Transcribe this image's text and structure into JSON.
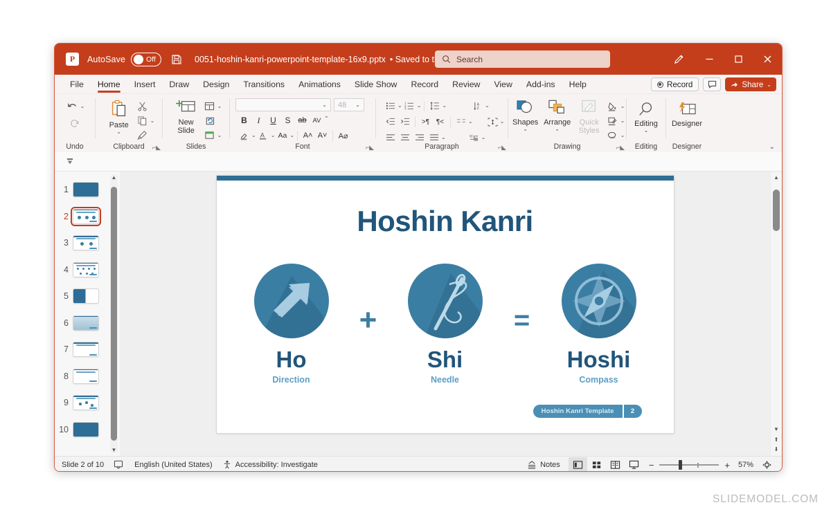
{
  "titlebar": {
    "app_icon": "powerpoint-logo-icon",
    "autosave_label": "AutoSave",
    "autosave_state": "Off",
    "save_icon": "save-icon",
    "document_title": "0051-hoshin-kanri-powerpoint-template-16x9.pptx",
    "save_status": "• Saved to this PC",
    "title_chevron": "⌄",
    "search_placeholder": "Search",
    "search_icon": "search-icon",
    "pen_icon": "pen-annotate-icon",
    "minimize": "—",
    "maximize": "▢",
    "close": "✕"
  },
  "ribbon": {
    "tabs": [
      {
        "label": "File",
        "active": false
      },
      {
        "label": "Home",
        "active": true
      },
      {
        "label": "Insert",
        "active": false
      },
      {
        "label": "Draw",
        "active": false
      },
      {
        "label": "Design",
        "active": false
      },
      {
        "label": "Transitions",
        "active": false
      },
      {
        "label": "Animations",
        "active": false
      },
      {
        "label": "Slide Show",
        "active": false
      },
      {
        "label": "Record",
        "active": false
      },
      {
        "label": "Review",
        "active": false
      },
      {
        "label": "View",
        "active": false
      },
      {
        "label": "Add-ins",
        "active": false
      },
      {
        "label": "Help",
        "active": false
      }
    ],
    "record_button": "Record",
    "comments_icon": "comment-icon",
    "share_button": "Share",
    "share_chevron": "⌄",
    "collapse_chevron": "⌄",
    "groups": [
      {
        "title": "Undo",
        "items": [
          "undo-icon",
          "redo-icon"
        ]
      },
      {
        "title": "Clipboard",
        "items": [
          "paste-icon",
          "cut-icon",
          "copy-icon",
          "format-painter-icon"
        ],
        "paste_label": "Paste"
      },
      {
        "title": "Slides",
        "items": [
          "new-slide-icon",
          "layout-icon",
          "reset-icon",
          "section-icon"
        ],
        "new_slide_label": "New\nSlide"
      },
      {
        "title": "Font",
        "font_name_value": "",
        "font_size_value": "48",
        "items": [
          "bold-icon",
          "italic-icon",
          "underline-icon",
          "shadow-icon",
          "strikethrough-icon",
          "character-spacing-icon",
          "text-highlight-icon",
          "font-color-icon",
          "change-case-icon",
          "increase-font-size-icon",
          "decrease-font-size-icon",
          "clear-formatting-icon"
        ]
      },
      {
        "title": "Paragraph",
        "items": [
          "bullets-icon",
          "numbering-icon",
          "line-spacing-icon",
          "text-direction-icon",
          "decrease-indent-icon",
          "increase-indent-icon",
          "ltr-icon",
          "rtl-icon",
          "columns-icon",
          "align-text-icon",
          "align-left-icon",
          "align-center-icon",
          "align-right-icon",
          "justify-icon",
          "convert-smartart-icon"
        ]
      },
      {
        "title": "Drawing",
        "shapes_label": "Shapes",
        "arrange_label": "Arrange",
        "quick_styles_label": "Quick\nStyles",
        "items": [
          "shapes-icon",
          "arrange-icon",
          "quick-styles-icon",
          "shape-fill-icon",
          "shape-outline-icon",
          "shape-effects-icon"
        ]
      },
      {
        "title": "Editing",
        "editing_label": "Editing",
        "items": [
          "find-icon"
        ]
      },
      {
        "title": "Designer",
        "designer_label": "Designer",
        "items": [
          "designer-icon"
        ]
      }
    ]
  },
  "thumbnails": {
    "selected": 2,
    "scroll_up_icon": "scroll-up-arrow-icon",
    "scroll_down_icon": "scroll-down-arrow-icon",
    "slides": [
      {
        "number": "1",
        "style": "filled"
      },
      {
        "number": "2",
        "style": "three-icons"
      },
      {
        "number": "3",
        "style": "two-icons"
      },
      {
        "number": "4",
        "style": "grid"
      },
      {
        "number": "5",
        "style": "half-left"
      },
      {
        "number": "6",
        "style": "chart"
      },
      {
        "number": "7",
        "style": "matrix"
      },
      {
        "number": "8",
        "style": "table"
      },
      {
        "number": "9",
        "style": "network"
      },
      {
        "number": "10",
        "style": "filled"
      }
    ]
  },
  "slide": {
    "title": "Hoshin Kanri",
    "blocks": [
      {
        "icon": "arrow-up-right-icon",
        "word": "Ho",
        "meaning": "Direction"
      },
      {
        "icon": "needle-thread-icon",
        "word": "Shi",
        "meaning": "Needle"
      },
      {
        "icon": "compass-icon",
        "word": "Hoshi",
        "meaning": "Compass"
      }
    ],
    "operator_plus": "+",
    "operator_equals": "=",
    "footer_label": "Hoshin Kanri Template",
    "footer_number": "2"
  },
  "canvas_scroll": {
    "up_icon": "scroll-up-arrow-icon",
    "down_icon": "scroll-down-arrow-icon",
    "prev_slide_icon": "previous-slide-icon",
    "next_slide_icon": "next-slide-icon"
  },
  "status_bar": {
    "slide_counter": "Slide 2 of 10",
    "notes_icon": "notes-page-icon",
    "language": "English (United States)",
    "accessibility_icon": "accessibility-icon",
    "accessibility": "Accessibility: Investigate",
    "notes_label": "Notes",
    "view_normal_icon": "normal-view-icon",
    "view_sorter_icon": "slide-sorter-icon",
    "view_reading_icon": "reading-view-icon",
    "view_slideshow_icon": "slideshow-view-icon",
    "zoom_out": "−",
    "zoom_in": "+",
    "zoom_level": "57%",
    "fit_icon": "fit-to-window-icon"
  },
  "watermark": "SLIDEMODEL.COM"
}
